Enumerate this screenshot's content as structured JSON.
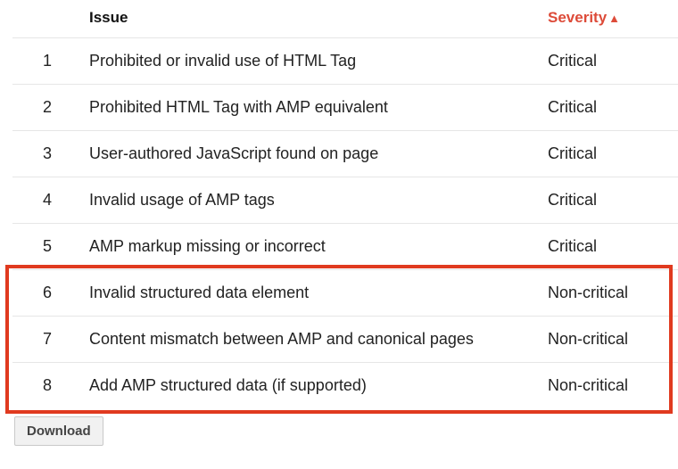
{
  "table": {
    "headers": {
      "issue": "Issue",
      "severity": "Severity"
    },
    "sort": {
      "column": "severity",
      "direction_icon": "▲"
    },
    "rows": [
      {
        "n": "1",
        "issue": "Prohibited or invalid use of HTML Tag",
        "severity": "Critical"
      },
      {
        "n": "2",
        "issue": "Prohibited HTML Tag with AMP equivalent",
        "severity": "Critical"
      },
      {
        "n": "3",
        "issue": "User-authored JavaScript found on page",
        "severity": "Critical"
      },
      {
        "n": "4",
        "issue": "Invalid usage of AMP tags",
        "severity": "Critical"
      },
      {
        "n": "5",
        "issue": "AMP markup missing or incorrect",
        "severity": "Critical"
      },
      {
        "n": "6",
        "issue": "Invalid structured data element",
        "severity": "Non-critical"
      },
      {
        "n": "7",
        "issue": "Content mismatch between AMP and canonical pages",
        "severity": "Non-critical"
      },
      {
        "n": "8",
        "issue": "Add AMP structured data (if supported)",
        "severity": "Non-critical"
      }
    ],
    "highlight_rows": [
      6,
      7,
      8
    ]
  },
  "actions": {
    "download_label": "Download"
  }
}
